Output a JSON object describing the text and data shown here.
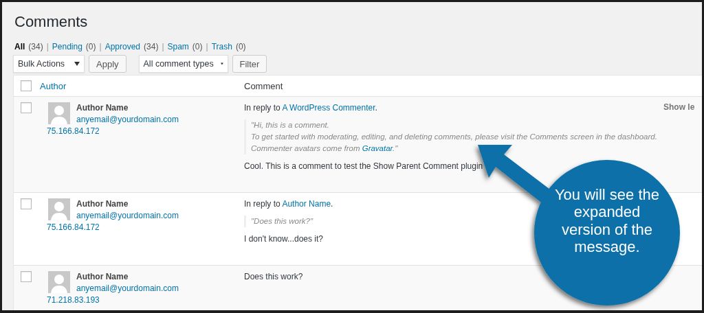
{
  "title": "Comments",
  "filter_separator": "|",
  "filters": [
    {
      "label": "All",
      "count": "(34)",
      "selected": true
    },
    {
      "label": "Pending",
      "count": "(0)",
      "selected": false
    },
    {
      "label": "Approved",
      "count": "(34)",
      "selected": false
    },
    {
      "label": "Spam",
      "count": "(0)",
      "selected": false
    },
    {
      "label": "Trash",
      "count": "(0)",
      "selected": false
    }
  ],
  "bulk_actions": {
    "value": "Bulk Actions",
    "apply": "Apply"
  },
  "type_filter": {
    "value": "All comment types",
    "filter": "Filter"
  },
  "table": {
    "columns": [
      "Author",
      "Comment"
    ],
    "header_checked": false,
    "rows": [
      {
        "checked": false,
        "author": "Author Name",
        "email": "anyemail@yourdomain.com",
        "ip": "75.166.84.172",
        "reply_prefix": "In reply to ",
        "reply_to": "A WordPress Commenter",
        "reply_suffix": ".",
        "quote": {
          "lines": [
            "\"Hi, this is a comment.",
            "To get started with moderating, editing, and deleting comments, please visit the Comments screen in the dashboard."
          ],
          "last_prefix": "Commenter avatars come from ",
          "link": "Gravatar",
          "last_suffix": ".\""
        },
        "comment": "Cool. This is a comment to test the Show Parent Comment plugin",
        "toggle": "Show le"
      },
      {
        "checked": false,
        "author": "Author Name",
        "email": "anyemail@yourdomain.com",
        "ip": "75.166.84.172",
        "reply_prefix": "In reply to ",
        "reply_to": "Author Name",
        "reply_suffix": ".",
        "quote": {
          "lines": [
            "\"Does this work?\""
          ]
        },
        "comment": "I don't know...does it?"
      },
      {
        "checked": false,
        "author": "Author Name",
        "email": "anyemail@yourdomain.com",
        "ip": "71.218.83.193",
        "comment": "Does this work?"
      }
    ]
  },
  "callout": {
    "text": "You will see the expanded version of the message."
  }
}
